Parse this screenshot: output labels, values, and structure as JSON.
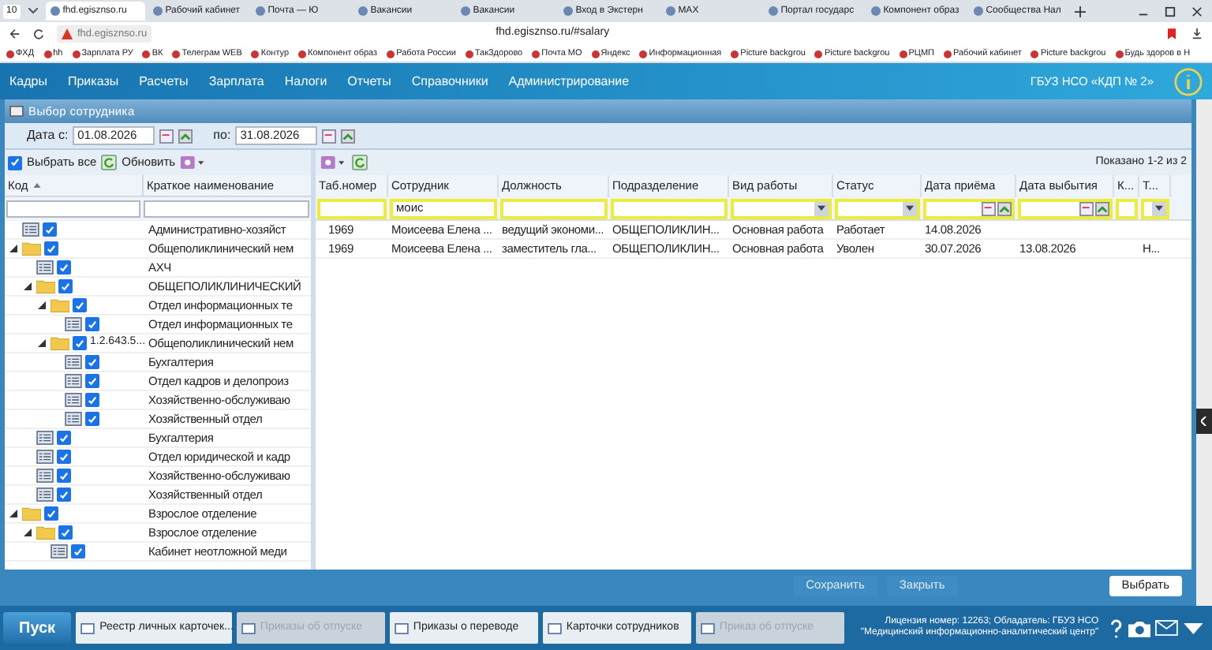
{
  "browser": {
    "tab_count": "10",
    "tabs": [
      {
        "title": "fhd.egisznso.ru",
        "selected": true
      },
      {
        "title": "Рабочий кабинет",
        "selected": false
      },
      {
        "title": "Почта — Ю",
        "selected": false
      },
      {
        "title": "Вакансии",
        "selected": false
      },
      {
        "title": "Вакансии",
        "selected": false
      },
      {
        "title": "Вход в Экстерн",
        "selected": false
      },
      {
        "title": "MAX",
        "selected": false
      },
      {
        "title": "Портал государс",
        "selected": false
      },
      {
        "title": "Компонент образ",
        "selected": false
      },
      {
        "title": "Сообщества Нал",
        "selected": false
      }
    ],
    "site_chip": "fhd.egisznso.ru",
    "address": "fhd.egisznso.ru/#salary",
    "bookmarks": [
      "ФХД",
      "hh",
      "Зарплата РУ",
      "ВК",
      "Телеграм WEB",
      "Контур",
      "Компонент образ",
      "Работа России",
      "ТакЗдорово",
      "Почта МО",
      "Яндекс",
      "Информационная",
      "Picture backgrou",
      "Picture backgrou",
      "РЦМП",
      "Рабочий кабинет",
      "Picture backgrou",
      "Будь здоров в Н"
    ]
  },
  "menu": {
    "items": [
      "Кадры",
      "Приказы",
      "Расчеты",
      "Зарплата",
      "Налоги",
      "Отчеты",
      "Справочники",
      "Администрирование"
    ],
    "organization": "ГБУЗ НСО «КДП № 2»"
  },
  "window": {
    "title": "Выбор сотрудника"
  },
  "dates": {
    "from_label": "Дата с:",
    "from_value": "01.08.2026",
    "to_label": "по:",
    "to_value": "31.08.2026"
  },
  "tree_toolbar": {
    "select_all": "Выбрать все",
    "select_all_checked": true,
    "refresh": "Обновить"
  },
  "tree": {
    "columns": [
      "Код",
      "Краткое наименование"
    ],
    "items": [
      {
        "kind": "leaf",
        "name": "Административно-хозяйст",
        "checked": true
      },
      {
        "kind": "folder",
        "name": "Общеполиклинический нем",
        "checked": true,
        "expanded": true,
        "children": [
          {
            "kind": "leaf",
            "name": "АХЧ",
            "checked": true
          },
          {
            "kind": "folder",
            "name": "ОБЩЕПОЛИКЛИНИЧЕСКИЙ",
            "checked": true,
            "expanded": true,
            "children": [
              {
                "kind": "folder",
                "name": "Отдел информационных те",
                "checked": true,
                "expanded": true,
                "children": [
                  {
                    "kind": "leaf",
                    "name": "Отдел информационных те",
                    "checked": true
                  }
                ]
              },
              {
                "kind": "folder",
                "code": "1.2.643.5...",
                "name": "Общеполиклинический нем",
                "checked": true,
                "expanded": true,
                "children": [
                  {
                    "kind": "leaf",
                    "name": "Бухгалтерия",
                    "checked": true
                  },
                  {
                    "kind": "leaf",
                    "name": "Отдел кадров и делопроиз",
                    "checked": true
                  },
                  {
                    "kind": "leaf",
                    "name": "Хозяйственно-обслуживаю",
                    "checked": true
                  },
                  {
                    "kind": "leaf",
                    "name": "Хозяйственный отдел",
                    "checked": true
                  }
                ]
              }
            ]
          },
          {
            "kind": "leaf",
            "name": "Бухгалтерия",
            "checked": true
          },
          {
            "kind": "leaf",
            "name": "Отдел юридической и кадр",
            "checked": true
          },
          {
            "kind": "leaf",
            "name": "Хозяйственно-обслуживаю",
            "checked": true
          },
          {
            "kind": "leaf",
            "name": "Хозяйственный отдел",
            "checked": true
          }
        ]
      },
      {
        "kind": "folder",
        "name": "Взрослое отделение",
        "checked": true,
        "expanded": true,
        "children": [
          {
            "kind": "folder",
            "name": "Взрослое отделение",
            "checked": true,
            "expanded": true,
            "children": [
              {
                "kind": "leaf",
                "name": "Кабинет неотложной меди",
                "checked": true
              }
            ]
          }
        ]
      }
    ]
  },
  "grid": {
    "summary": "Показано 1-2 из 2",
    "columns": [
      {
        "label": "Таб.номер",
        "filter": {
          "kind": "text"
        }
      },
      {
        "label": "Сотрудник",
        "filter": {
          "kind": "text",
          "value": "моис"
        }
      },
      {
        "label": "Должность",
        "filter": {
          "kind": "text"
        }
      },
      {
        "label": "Подразделение",
        "filter": {
          "kind": "text"
        }
      },
      {
        "label": "Вид работы",
        "filter": {
          "kind": "select"
        }
      },
      {
        "label": "Статус",
        "filter": {
          "kind": "select"
        }
      },
      {
        "label": "Дата приёма",
        "filter": {
          "kind": "date"
        }
      },
      {
        "label": "Дата выбытия",
        "filter": {
          "kind": "date"
        }
      },
      {
        "label": "К...",
        "filter": {
          "kind": "text"
        }
      },
      {
        "label": "Т...",
        "filter": {
          "kind": "select"
        }
      }
    ],
    "rows": [
      {
        "tab_number": "1969",
        "employee": "Моисеева Елена ...",
        "position": "ведущий экономи...",
        "department": "ОБЩЕПОЛИКЛИН...",
        "work_type": "Основная работа",
        "status": "Работает",
        "hire_date": "14.08.2026"
      },
      {
        "tab_number": "1969",
        "employee": "Моисеева Елена ...",
        "position": "заместитель гла...",
        "department": "ОБЩЕПОЛИКЛИН...",
        "work_type": "Основная работа",
        "status": "Уволен",
        "hire_date": "30.07.2026",
        "leave_date": "13.08.2026",
        "column_10": "Н..."
      }
    ]
  },
  "footer_buttons": [
    {
      "label": "Сохранить",
      "disabled": true
    },
    {
      "label": "Закрыть",
      "disabled": true
    },
    {
      "label": "Выбрать",
      "disabled": false
    }
  ],
  "taskbar": {
    "start": "Пуск",
    "tasks": [
      {
        "title": "Реестр личных карточек...",
        "disabled": false
      },
      {
        "title": "Приказы об отпуске",
        "disabled": true
      },
      {
        "title": "Приказы о переводе",
        "disabled": false
      },
      {
        "title": "Карточки сотрудников",
        "disabled": false
      },
      {
        "title": "Приказ об отпуске",
        "disabled": true
      }
    ],
    "license": "Лицензия номер: 12263; Обладатель: ГБУЗ НСО \"Медицинский информационно-аналитический центр\""
  }
}
